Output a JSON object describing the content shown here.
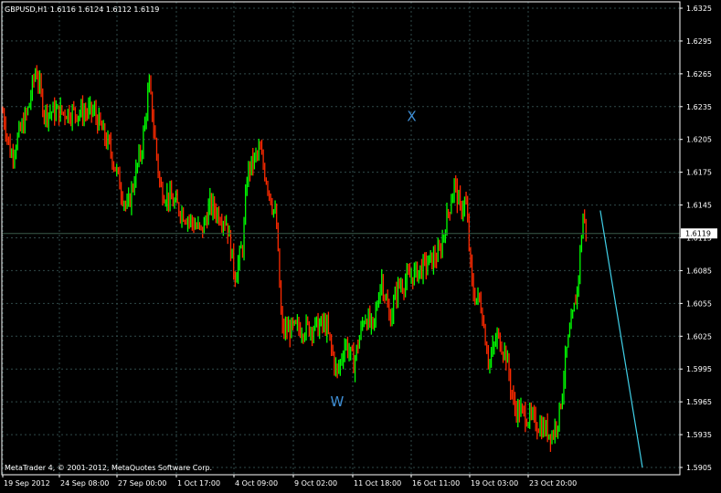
{
  "symbol_header": "GBPUSD,H1  1.6116 1.6124 1.6112 1.6119",
  "copyright": "MetaTrader 4, © 2001-2012, MetaQuotes Software Corp.",
  "current_price_label": "1.6119",
  "colors": {
    "background": "#000000",
    "frame": "#ffffff",
    "grid": "#314a4a",
    "bull": "#00ff00",
    "bear": "#ff2a00",
    "wave_label": "#3f8fd6",
    "trendline": "#40d0e8",
    "bid_line": "#3a5a4a"
  },
  "wave_labels": [
    {
      "text": "X",
      "date": "13 Oct 2012 16:00",
      "price": 1.6222
    },
    {
      "text": "W",
      "date": "9 Oct 2012 04:00",
      "price": 1.5961
    }
  ],
  "chart_data": {
    "type": "candlestick",
    "title": "GBPUSD,H1",
    "timeframe": "H1",
    "last_bar": {
      "open": 1.6116,
      "high": 1.6124,
      "low": 1.6112,
      "close": 1.6119
    },
    "current_price": 1.6119,
    "ylim": [
      1.5905,
      1.6325
    ],
    "y_ticks": [
      "1.6325",
      "1.6295",
      "1.6265",
      "1.6235",
      "1.6205",
      "1.6175",
      "1.6145",
      "1.6115",
      "1.6085",
      "1.6055",
      "1.6025",
      "1.5995",
      "1.5965",
      "1.5935",
      "1.5905"
    ],
    "x_ticks": [
      "19 Sep 2012",
      "24 Sep 08:00",
      "27 Sep 00:00",
      "1 Oct 17:00",
      "4 Oct 09:00",
      "9 Oct 02:00",
      "11 Oct 18:00",
      "16 Oct 11:00",
      "19 Oct 03:00",
      "23 Oct 20:00"
    ],
    "grid": true,
    "price_path": [
      {
        "date": "19 Sep 2012 00:00",
        "price": 1.623
      },
      {
        "date": "19 Sep 2012 12:00",
        "price": 1.619
      },
      {
        "date": "20 Sep 2012 12:00",
        "price": 1.623
      },
      {
        "date": "21 Sep 2012 00:00",
        "price": 1.627
      },
      {
        "date": "21 Sep 2012 12:00",
        "price": 1.623
      },
      {
        "date": "24 Sep 2012 12:00",
        "price": 1.623
      },
      {
        "date": "25 Sep 2012 12:00",
        "price": 1.6195
      },
      {
        "date": "26 Sep 2012 12:00",
        "price": 1.614
      },
      {
        "date": "27 Sep 2012 10:00",
        "price": 1.62
      },
      {
        "date": "27 Sep 2012 20:00",
        "price": 1.6255
      },
      {
        "date": "28 Sep 2012 12:00",
        "price": 1.616
      },
      {
        "date": "1 Oct 2012 00:00",
        "price": 1.612
      },
      {
        "date": "1 Oct 2012 12:00",
        "price": 1.6145
      },
      {
        "date": "2 Oct 2012 12:00",
        "price": 1.613
      },
      {
        "date": "3 Oct 2012 00:00",
        "price": 1.608
      },
      {
        "date": "3 Oct 2012 12:00",
        "price": 1.611
      },
      {
        "date": "3 Oct 2012 18:00",
        "price": 1.6175
      },
      {
        "date": "4 Oct 2012 12:00",
        "price": 1.6195
      },
      {
        "date": "5 Oct 2012 12:00",
        "price": 1.613
      },
      {
        "date": "5 Oct 2012 20:00",
        "price": 1.603
      },
      {
        "date": "8 Oct 2012 12:00",
        "price": 1.6035
      },
      {
        "date": "9 Oct 2012 04:00",
        "price": 1.599
      },
      {
        "date": "9 Oct 2012 16:00",
        "price": 1.602
      },
      {
        "date": "10 Oct 2012 04:00",
        "price": 1.6
      },
      {
        "date": "10 Oct 2012 20:00",
        "price": 1.6045
      },
      {
        "date": "11 Oct 2012 08:00",
        "price": 1.603
      },
      {
        "date": "11 Oct 2012 20:00",
        "price": 1.608
      },
      {
        "date": "12 Oct 2012 08:00",
        "price": 1.604
      },
      {
        "date": "12 Oct 2012 20:00",
        "price": 1.607
      },
      {
        "date": "15 Oct 2012 08:00",
        "price": 1.61
      },
      {
        "date": "15 Oct 2012 18:00",
        "price": 1.613
      },
      {
        "date": "16 Oct 2012 06:00",
        "price": 1.6165
      },
      {
        "date": "16 Oct 2012 14:00",
        "price": 1.614
      },
      {
        "date": "16 Oct 2012 22:00",
        "price": 1.615
      },
      {
        "date": "17 Oct 2012 08:00",
        "price": 1.6065
      },
      {
        "date": "17 Oct 2012 20:00",
        "price": 1.6055
      },
      {
        "date": "18 Oct 2012 08:00",
        "price": 1.6
      },
      {
        "date": "18 Oct 2012 20:00",
        "price": 1.6025
      },
      {
        "date": "19 Oct 2012 08:00",
        "price": 1.601
      },
      {
        "date": "19 Oct 2012 20:00",
        "price": 1.596
      },
      {
        "date": "22 Oct 2012 04:00",
        "price": 1.5935
      },
      {
        "date": "22 Oct 2012 14:00",
        "price": 1.5955
      },
      {
        "date": "23 Oct 2012 00:00",
        "price": 1.601
      },
      {
        "date": "23 Oct 2012 10:00",
        "price": 1.6045
      },
      {
        "date": "23 Oct 2012 16:00",
        "price": 1.607
      },
      {
        "date": "24 Oct 2012 00:00",
        "price": 1.6135
      },
      {
        "date": "24 Oct 2012 06:00",
        "price": 1.6119
      }
    ],
    "trendline": {
      "start": {
        "date": "25 Oct 2012 01:00",
        "price": 1.614
      },
      "end": {
        "date": "27 Oct 2012 14:00",
        "price": 1.5905
      }
    }
  }
}
